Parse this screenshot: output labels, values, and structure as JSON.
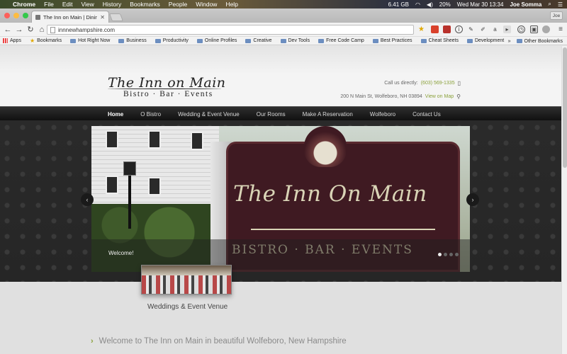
{
  "menubar": {
    "apple": "",
    "app": "Chrome",
    "items": [
      "File",
      "Edit",
      "View",
      "History",
      "Bookmarks",
      "People",
      "Window",
      "Help"
    ],
    "disk": "6.41 GB",
    "battery": "20%",
    "datetime": "Wed Mar 30  13:34",
    "user": "Joe Somma"
  },
  "browser": {
    "tab_title": "The Inn on Main | Dining a",
    "url": "innnewhampshire.com",
    "profile": "Joe",
    "bookmarks": [
      {
        "label": "Apps",
        "kind": "apps"
      },
      {
        "label": "Bookmarks",
        "kind": "star"
      },
      {
        "label": "Hot Right Now",
        "kind": "folder"
      },
      {
        "label": "Business",
        "kind": "folder"
      },
      {
        "label": "Productivity",
        "kind": "folder"
      },
      {
        "label": "Online Profiles",
        "kind": "folder"
      },
      {
        "label": "Creative",
        "kind": "folder"
      },
      {
        "label": "Dev Tools",
        "kind": "folder"
      },
      {
        "label": "Free Code Camp",
        "kind": "folder"
      },
      {
        "label": "Best Practices",
        "kind": "folder"
      },
      {
        "label": "Cheat Sheets",
        "kind": "folder"
      },
      {
        "label": "Development",
        "kind": "folder"
      }
    ],
    "more_bookmarks": "»",
    "other_bookmarks": "Other Bookmarks"
  },
  "site": {
    "logo_main": "The Inn on Main",
    "logo_sub": "Bistro · Bar · Events",
    "call_label": "Call us directly:",
    "phone": "(603) 569-1335",
    "address": "200 N Main St, Wolfeboro, NH 03894",
    "map_link": "View on Map",
    "nav": [
      "Home",
      "O Bistro",
      "Wedding & Event Venue",
      "Our Rooms",
      "Make A Reservation",
      "Wolfeboro",
      "Contact Us"
    ],
    "slide": {
      "sign_title": "The Inn On Main",
      "sign_sub": "BISTRO · BAR · EVENTS",
      "caption": "Welcome!",
      "dot_count": 4,
      "active_dot": 0
    },
    "feature_label": "Weddings & Event Venue",
    "welcome_text": "Welcome to The Inn on Main in beautiful Wolfeboro, New Hampshire"
  },
  "colors": {
    "accent_green": "#8aa13a",
    "nav_bg": "#1a1a1a",
    "sign_bg": "#3f1a22"
  }
}
